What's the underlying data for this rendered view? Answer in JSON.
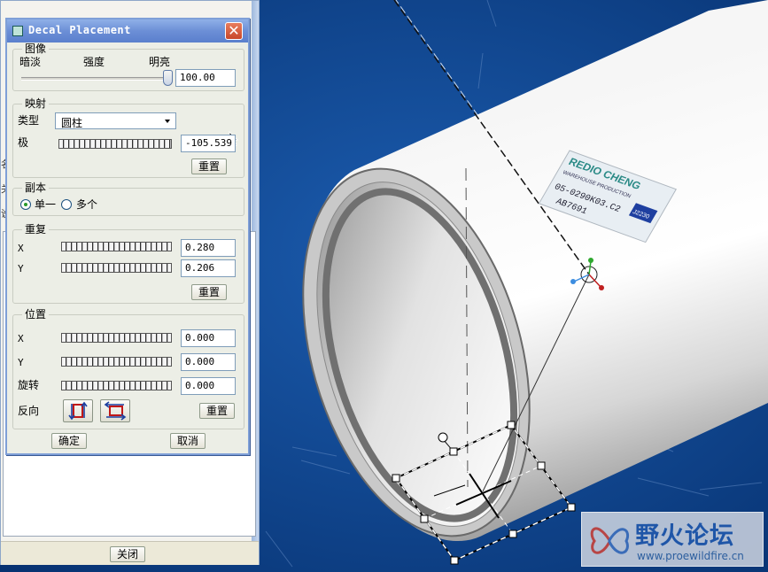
{
  "dialog": {
    "title": "Decal Placement",
    "close_glyph": "✕",
    "image_group": {
      "legend": "图像",
      "label_dark": "暗淡",
      "label_intensity": "强度",
      "label_bright": "明亮",
      "value": "100.00"
    },
    "map_group": {
      "legend": "映射",
      "type_label": "类型",
      "type_value": "圆柱",
      "pole_label": "极",
      "pole_value": "-105.539",
      "reset_label": "重置"
    },
    "copy_group": {
      "legend": "副本",
      "option_single": "单一",
      "option_multiple": "多个",
      "selected": "单一"
    },
    "repeat_group": {
      "legend": "重复",
      "x_label": "X",
      "x_value": "0.280",
      "y_label": "Y",
      "y_value": "0.206",
      "reset_label": "重置"
    },
    "position_group": {
      "legend": "位置",
      "x_label": "X",
      "x_value": "0.000",
      "y_label": "Y",
      "y_value": "0.000",
      "rotate_label": "旋转",
      "rotate_value": "0.000",
      "flip_label": "反向",
      "reset_label": "重置"
    },
    "ok_label": "确定",
    "cancel_label": "取消"
  },
  "back_panel": {
    "close_label": "关闭",
    "side_glyphs": [
      "名",
      "关",
      "说"
    ]
  },
  "decal": {
    "line1": "REDIO CHENG",
    "line2": "WAREHOUSE PRODUCTION",
    "line3": "05-0290K03.C2",
    "line4": "AB7691",
    "badge": "J2230"
  },
  "watermark": {
    "title": "野火论坛",
    "url": "www.proewildfire.cn"
  },
  "colors": {
    "background": "#0d3f86",
    "titlebar": "#6c8fd6",
    "dialog_bg": "#eceee6"
  },
  "icons": {
    "close": "close-icon",
    "dropdown": "chevron-down-icon",
    "flip_vertical": "flip-vertical-icon",
    "flip_horizontal": "flip-horizontal-icon",
    "cursor": "mouse-pointer-icon"
  }
}
